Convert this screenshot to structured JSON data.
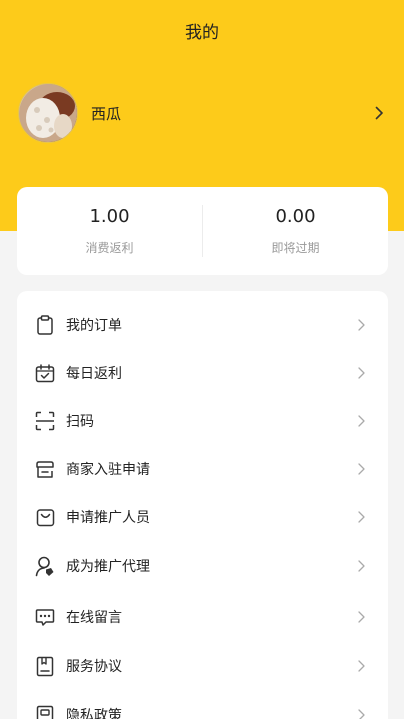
{
  "header": {
    "title": "我的",
    "background_color": "#fdcb1a"
  },
  "profile": {
    "username": "西瓜",
    "avatar_icon": "avatar-photo",
    "chevron_icon": "chevron-right-icon"
  },
  "stats": [
    {
      "value": "1.00",
      "label": "消费返利"
    },
    {
      "value": "0.00",
      "label": "即将过期"
    }
  ],
  "menu": {
    "items": [
      {
        "label": "我的订单",
        "icon": "clipboard-icon"
      },
      {
        "label": "每日返利",
        "icon": "calendar-check-icon"
      },
      {
        "label": "扫码",
        "icon": "scan-icon"
      },
      {
        "label": "商家入驻申请",
        "icon": "store-icon"
      },
      {
        "label": "申请推广人员",
        "icon": "bag-icon"
      },
      {
        "label": "成为推广代理",
        "icon": "agent-icon"
      },
      {
        "label": "在线留言",
        "icon": "message-icon"
      },
      {
        "label": "服务协议",
        "icon": "document-icon"
      },
      {
        "label": "隐私政策",
        "icon": "privacy-icon"
      }
    ]
  }
}
